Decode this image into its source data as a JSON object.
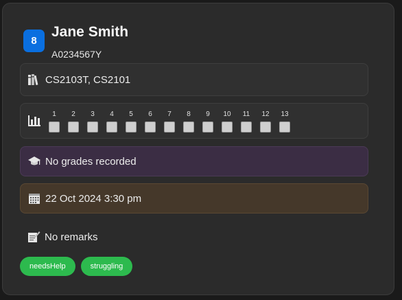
{
  "student": {
    "index": "8",
    "name": "Jane Smith",
    "matric": "A0234567Y"
  },
  "modules": {
    "icon": "books-icon",
    "text": "CS2103T, CS2101"
  },
  "attendance": {
    "icon": "attendance-chart-icon",
    "weeks": [
      "1",
      "2",
      "3",
      "4",
      "5",
      "6",
      "7",
      "8",
      "9",
      "10",
      "11",
      "12",
      "13"
    ],
    "attended": [
      false,
      false,
      false,
      false,
      false,
      false,
      false,
      false,
      false,
      false,
      false,
      false,
      false
    ]
  },
  "grades": {
    "icon": "graduation-cap-icon",
    "text": "No grades recorded"
  },
  "consultation": {
    "icon": "calendar-icon",
    "text": "22 Oct 2024 3:30 pm"
  },
  "remarks": {
    "icon": "memo-icon",
    "text": "No remarks"
  },
  "tags": [
    "needsHelp",
    "struggling"
  ],
  "colors": {
    "badge": "#0a6fe0",
    "tag": "#2dba4e",
    "grades_bg": "#3b2d44",
    "date_bg": "#45382a"
  }
}
